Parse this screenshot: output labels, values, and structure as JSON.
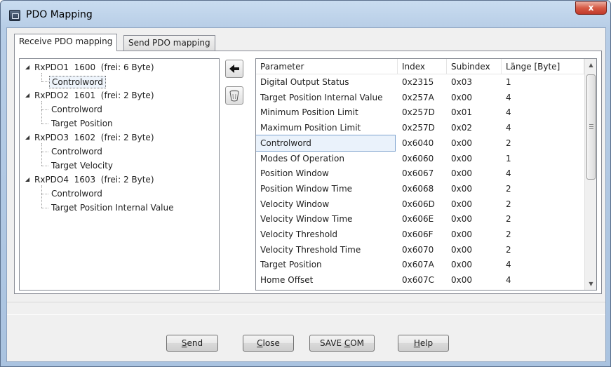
{
  "window": {
    "title": "PDO Mapping",
    "close_glyph": "x"
  },
  "tabs": [
    {
      "label": "Receive PDO mapping",
      "active": true
    },
    {
      "label": "Send PDO mapping",
      "active": false
    }
  ],
  "tree": [
    {
      "label": "RxPDO1  1600  (frei: 6 Byte)",
      "children": [
        "Controlword"
      ]
    },
    {
      "label": "RxPDO2  1601  (frei: 2 Byte)",
      "children": [
        "Controlword",
        "Target Position"
      ]
    },
    {
      "label": "RxPDO3  1602  (frei: 2 Byte)",
      "children": [
        "Controlword",
        "Target Velocity"
      ]
    },
    {
      "label": "RxPDO4  1603  (frei: 2 Byte)",
      "children": [
        "Controlword",
        "Target Position Internal Value"
      ]
    }
  ],
  "tools": {
    "add_icon": "arrow-left-icon",
    "delete_icon": "trash-icon"
  },
  "table": {
    "headers": [
      "Parameter",
      "Index",
      "Subindex",
      "Länge [Byte]"
    ],
    "rows": [
      [
        "Digital Output Status",
        "0x2315",
        "0x03",
        "1"
      ],
      [
        "Target Position Internal Value",
        "0x257A",
        "0x00",
        "4"
      ],
      [
        "Minimum Position Limit",
        "0x257D",
        "0x01",
        "4"
      ],
      [
        "Maximum Position Limit",
        "0x257D",
        "0x02",
        "4"
      ],
      [
        "Controlword",
        "0x6040",
        "0x00",
        "2"
      ],
      [
        "Modes Of Operation",
        "0x6060",
        "0x00",
        "1"
      ],
      [
        "Position Window",
        "0x6067",
        "0x00",
        "4"
      ],
      [
        "Position Window Time",
        "0x6068",
        "0x00",
        "2"
      ],
      [
        "Velocity Window",
        "0x606D",
        "0x00",
        "2"
      ],
      [
        "Velocity Window Time",
        "0x606E",
        "0x00",
        "2"
      ],
      [
        "Velocity Threshold",
        "0x606F",
        "0x00",
        "2"
      ],
      [
        "Velocity Threshold Time",
        "0x6070",
        "0x00",
        "2"
      ],
      [
        "Target Position",
        "0x607A",
        "0x00",
        "4"
      ],
      [
        "Home Offset",
        "0x607C",
        "0x00",
        "4"
      ]
    ],
    "highlighted_row": 4
  },
  "buttons": {
    "send": {
      "pre": "",
      "u": "S",
      "post": "end"
    },
    "close": {
      "pre": "",
      "u": "C",
      "post": "lose"
    },
    "save_com": {
      "pre": "SAVE ",
      "u": "C",
      "post": "OM"
    },
    "help": {
      "pre": "",
      "u": "H",
      "post": "elp"
    }
  },
  "colors": {
    "title_bar": "#b7cde6",
    "close_button": "#c0392b",
    "selection": "#7da2ce"
  }
}
